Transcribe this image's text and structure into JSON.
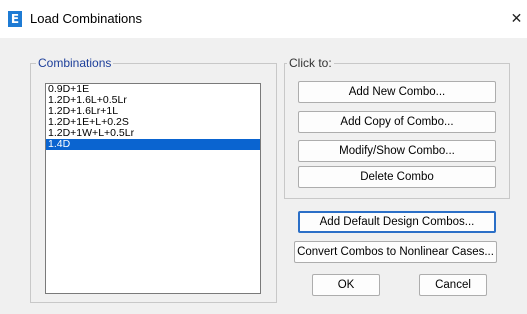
{
  "window": {
    "title": "Load Combinations",
    "app_icon_glyph": "E",
    "app_icon_name": "etabs-app-icon",
    "close_glyph": "✕"
  },
  "combinations": {
    "group_label": "Combinations",
    "items": [
      {
        "label": "0.9D+1E",
        "selected": false
      },
      {
        "label": "1.2D+1.6L+0.5Lr",
        "selected": false
      },
      {
        "label": "1.2D+1.6Lr+1L",
        "selected": false
      },
      {
        "label": "1.2D+1E+L+0.2S",
        "selected": false
      },
      {
        "label": "1.2D+1W+L+0.5Lr",
        "selected": false
      },
      {
        "label": "1.4D",
        "selected": true
      }
    ]
  },
  "click_to": {
    "group_label": "Click to:",
    "add_new_label": "Add New Combo...",
    "add_copy_label": "Add Copy of Combo...",
    "modify_show_label": "Modify/Show Combo...",
    "delete_label": "Delete Combo"
  },
  "actions": {
    "add_default_label": "Add Default Design Combos...",
    "convert_label": "Convert Combos to Nonlinear Cases...",
    "ok_label": "OK",
    "cancel_label": "Cancel"
  },
  "colors": {
    "selection": "#0a64d0",
    "focus_border": "#2b6fc7",
    "app_icon": "#1e7bd4",
    "group_label_blue": "#1d3f9a"
  }
}
